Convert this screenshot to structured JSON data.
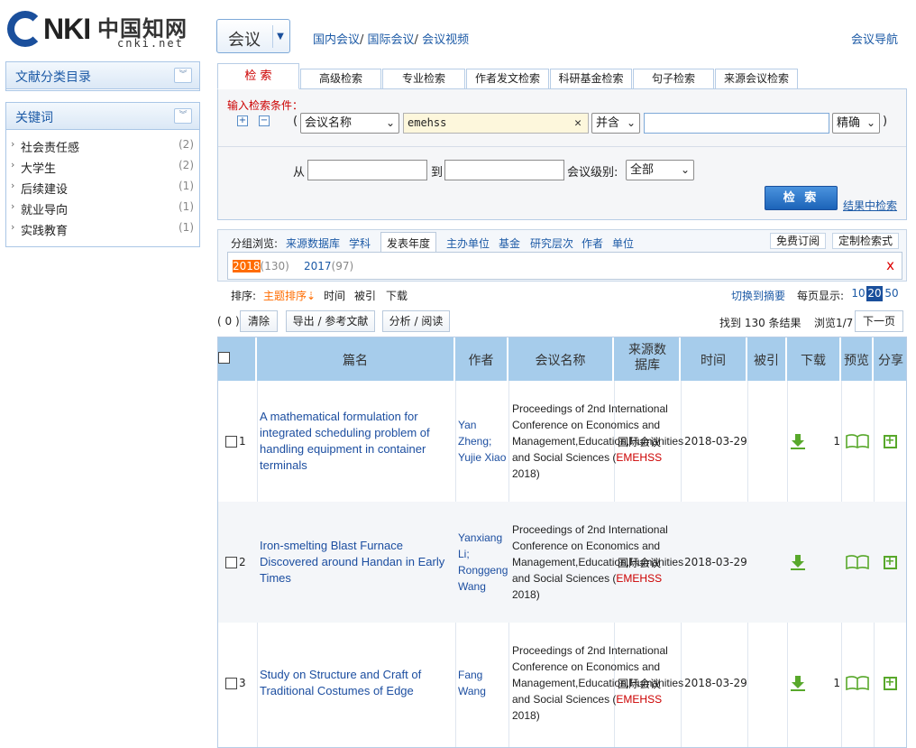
{
  "header": {
    "logo_main": "NKI",
    "logo_cn": "中国知网",
    "logo_net": "cnki.net",
    "db_label": "会议",
    "top_links": [
      "国内会议",
      "国际会议",
      "会议视频"
    ],
    "conf_nav": "会议导航"
  },
  "sidebar": {
    "catalog_title": "文献分类目录",
    "keywords_title": "关键词",
    "keywords": [
      {
        "name": "社会责任感",
        "count": "(2)"
      },
      {
        "name": "大学生",
        "count": "(2)"
      },
      {
        "name": "后续建设",
        "count": "(1)"
      },
      {
        "name": "就业导向",
        "count": "(1)"
      },
      {
        "name": "实践教育",
        "count": "(1)"
      }
    ]
  },
  "search": {
    "tabs": [
      "检 索",
      "高级检索",
      "专业检索",
      "作者发文检索",
      "科研基金检索",
      "句子检索",
      "来源会议检索"
    ],
    "condition_label": "输入检索条件：",
    "field_select": "会议名称",
    "keyword_value": "emehss",
    "logic_select": "并含",
    "match_select": "精确",
    "from_label": "从",
    "to_label": "到",
    "level_label": "会议级别:",
    "level_select": "全部",
    "search_button": "检 索",
    "in_result_link": "结果中检索"
  },
  "grouping": {
    "label": "分组浏览:",
    "items": [
      "来源数据库",
      "学科",
      "发表年度",
      "主办单位",
      "基金",
      "研究层次",
      "作者",
      "单位"
    ],
    "free_subscribe": "免费订阅",
    "custom_expr": "定制检索式",
    "years": [
      {
        "year": "2018",
        "count": "(130)"
      },
      {
        "year": "2017",
        "count": "(97)"
      }
    ],
    "close": "x"
  },
  "sorting": {
    "label": "排序:",
    "topic": "主题排序",
    "time": "时间",
    "cited": "被引",
    "download": "下载",
    "switch_abstract": "切换到摘要",
    "per_page_label": "每页显示:",
    "per_page_options": [
      "10",
      "20",
      "50"
    ]
  },
  "toolbar": {
    "selected_count": "( 0 )",
    "clear": "清除",
    "export": "导出 / 参考文献",
    "analyze": "分析 / 阅读",
    "found": "找到 130 条结果",
    "browse": "浏览1/7",
    "next_page": "下一页"
  },
  "table": {
    "headers": [
      "篇名",
      "作者",
      "会议名称",
      "来源数据库",
      "时间",
      "被引",
      "下载",
      "预览",
      "分享"
    ],
    "rows": [
      {
        "no": "1",
        "title": "A mathematical formulation for integrated scheduling problem of handling equipment in container terminals",
        "author": "Yan Zheng; Yujie Xiao",
        "conf_prefix": "Proceedings of 2nd International Conference on Economics and Management,Education,Humanities and Social Sciences (",
        "conf_abbr": "EMEHSS",
        "conf_suffix": " 2018)",
        "source": "国际会议",
        "date": "2018-03-29",
        "cited": "",
        "downloads": "1"
      },
      {
        "no": "2",
        "title": "Iron-smelting Blast Furnace Discovered around Handan in Early Times",
        "author": "Yanxiang Li; Ronggeng Wang",
        "conf_prefix": "Proceedings of 2nd International Conference on Economics and Management,Education,Humanities and Social Sciences (",
        "conf_abbr": "EMEHSS",
        "conf_suffix": " 2018)",
        "source": "国际会议",
        "date": "2018-03-29",
        "cited": "",
        "downloads": ""
      },
      {
        "no": "3",
        "title": "Study on Structure and Craft of Traditional Costumes of Edge",
        "author": "Fang Wang",
        "conf_prefix": "Proceedings of 2nd International Conference on Economics and Management,Education,Humanities and Social Sciences (",
        "conf_abbr": "EMEHSS",
        "conf_suffix": " 2018)",
        "source": "国际会议",
        "date": "2018-03-29",
        "cited": "",
        "downloads": "1"
      }
    ]
  },
  "colors": {
    "brand_blue": "#1a4f9c",
    "link_blue": "#1c5aa6",
    "accent_orange": "#ff6c00",
    "header_cell": "#a6cceb",
    "icon_green": "#58a82b"
  }
}
